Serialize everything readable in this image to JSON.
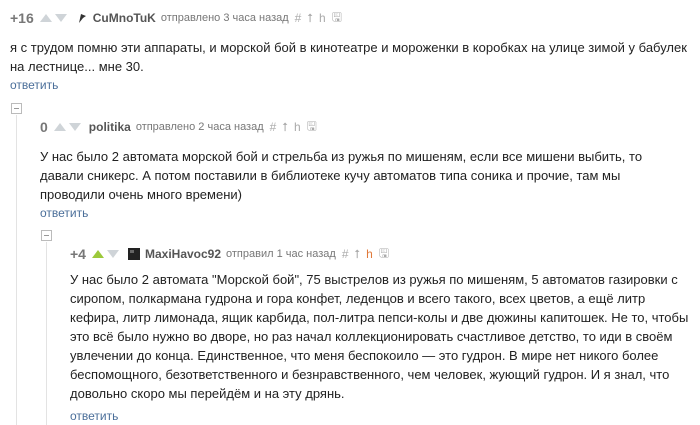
{
  "comments": [
    {
      "rating": "+16",
      "author": "CuMnoTuK",
      "meta": "отправлено 3 часа назад",
      "text": "я с трудом помню эти аппараты, и морской бой в кинотеатре и мороженки в коробках на улице зимой у бабулек на лестнице... мне 30.",
      "reply_label": "ответить"
    },
    {
      "rating": "0",
      "author": "politika",
      "meta": "отправлено 2 часа назад",
      "text": "У нас было 2 автомата морской бой и стрельба из ружья по мишеням, если все мишени выбить, то давали сникерс. А потом поставили в библиотеке кучу автоматов типа соника и прочие, там мы проводили очень много времени)",
      "reply_label": "ответить"
    },
    {
      "rating": "+4",
      "author": "MaxiHavoc92",
      "meta": "отправил 1 час назад",
      "text": "У нас было 2 автомата \"Морской бой\", 75 выстрелов из ружья по мишеням, 5 автоматов газировки с сиропом, полкармана гудрона и гора конфет, леденцов и всего такого, всех цветов, а ещё литр кефира, литр лимонада, ящик карбида, пол-литра пепси-колы и две дюжины капитошек. Не то, чтобы это всё было нужно во дворе, но раз начал коллекционировать счастливое детство, то иди в своём увлечении до конца. Единственное, что меня беспокоило — это гудрон. В мире нет никого более беспомощного, безответственного и безнравственного, чем человек, жующий гудрон. И я знал, что довольно скоро мы перейдём и на эту дрянь.",
      "reply_label": "ответить"
    }
  ],
  "tools_glyphs": [
    "#",
    "⭡",
    "h",
    "🖫"
  ],
  "colors": {
    "link": "#4a6e99",
    "vote_up_active": "#9cc93b",
    "highlight_tool": "#e07a3b"
  }
}
